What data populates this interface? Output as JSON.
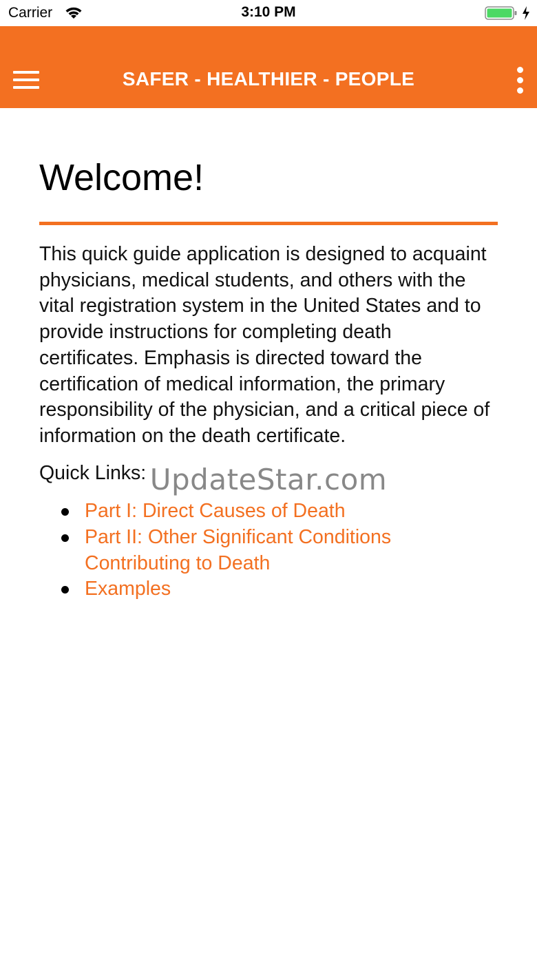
{
  "status_bar": {
    "carrier": "Carrier",
    "time": "3:10 PM",
    "icons": [
      "wifi-icon",
      "battery-icon",
      "charging-icon"
    ]
  },
  "header": {
    "title": "SAFER - HEALTHIER - PEOPLE",
    "menu_icon": "hamburger-menu-icon",
    "overflow_icon": "vertical-dots-icon",
    "background_color": "#F37021"
  },
  "main": {
    "title": "Welcome!",
    "intro": "This quick guide application is designed to acquaint physicians, medical students, and others with the vital registration system in the United States and to provide instructions for completing death certificates. Emphasis is directed toward the certification of medical information, the primary responsibility of the physician, and a critical piece of information on the death certificate.",
    "quick_links_label": "Quick Links:",
    "links": [
      {
        "label": "Part I: Direct Causes of Death"
      },
      {
        "label": "Part II: Other Significant Conditions Contributing to Death"
      },
      {
        "label": "Examples"
      }
    ],
    "accent_color": "#F37021"
  },
  "watermark": "UpdateStar.com"
}
